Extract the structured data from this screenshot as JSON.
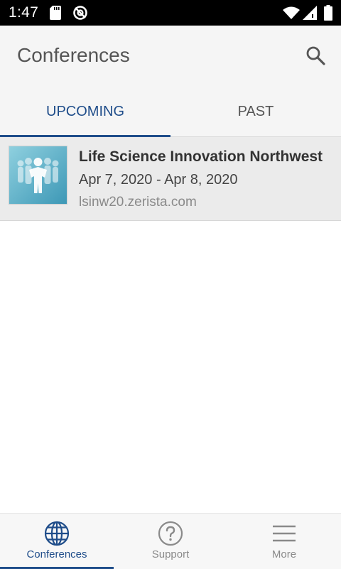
{
  "status_bar": {
    "time": "1:47",
    "icons": [
      "sd-card-icon",
      "no-sync-icon",
      "wifi-icon",
      "signal-icon",
      "battery-icon"
    ]
  },
  "app_bar": {
    "title": "Conferences",
    "search_icon": "search-icon"
  },
  "tabs": [
    {
      "label": "UPCOMING",
      "selected": true
    },
    {
      "label": "PAST",
      "selected": false
    }
  ],
  "conferences": [
    {
      "name": "Life Science Innovation Northwest",
      "dates": "Apr 7, 2020 - Apr 8, 2020",
      "url": "lsinw20.zerista.com",
      "logo_icon": "people-group-logo"
    }
  ],
  "bottom_nav": [
    {
      "label": "Conferences",
      "icon": "globe-icon",
      "selected": true
    },
    {
      "label": "Support",
      "icon": "help-circle-icon",
      "selected": false
    },
    {
      "label": "More",
      "icon": "menu-icon",
      "selected": false
    }
  ],
  "colors": {
    "accent": "#1f4d8a",
    "status_bar": "#000000",
    "app_bar": "#f5f5f5",
    "list_item": "#ebebeb"
  }
}
